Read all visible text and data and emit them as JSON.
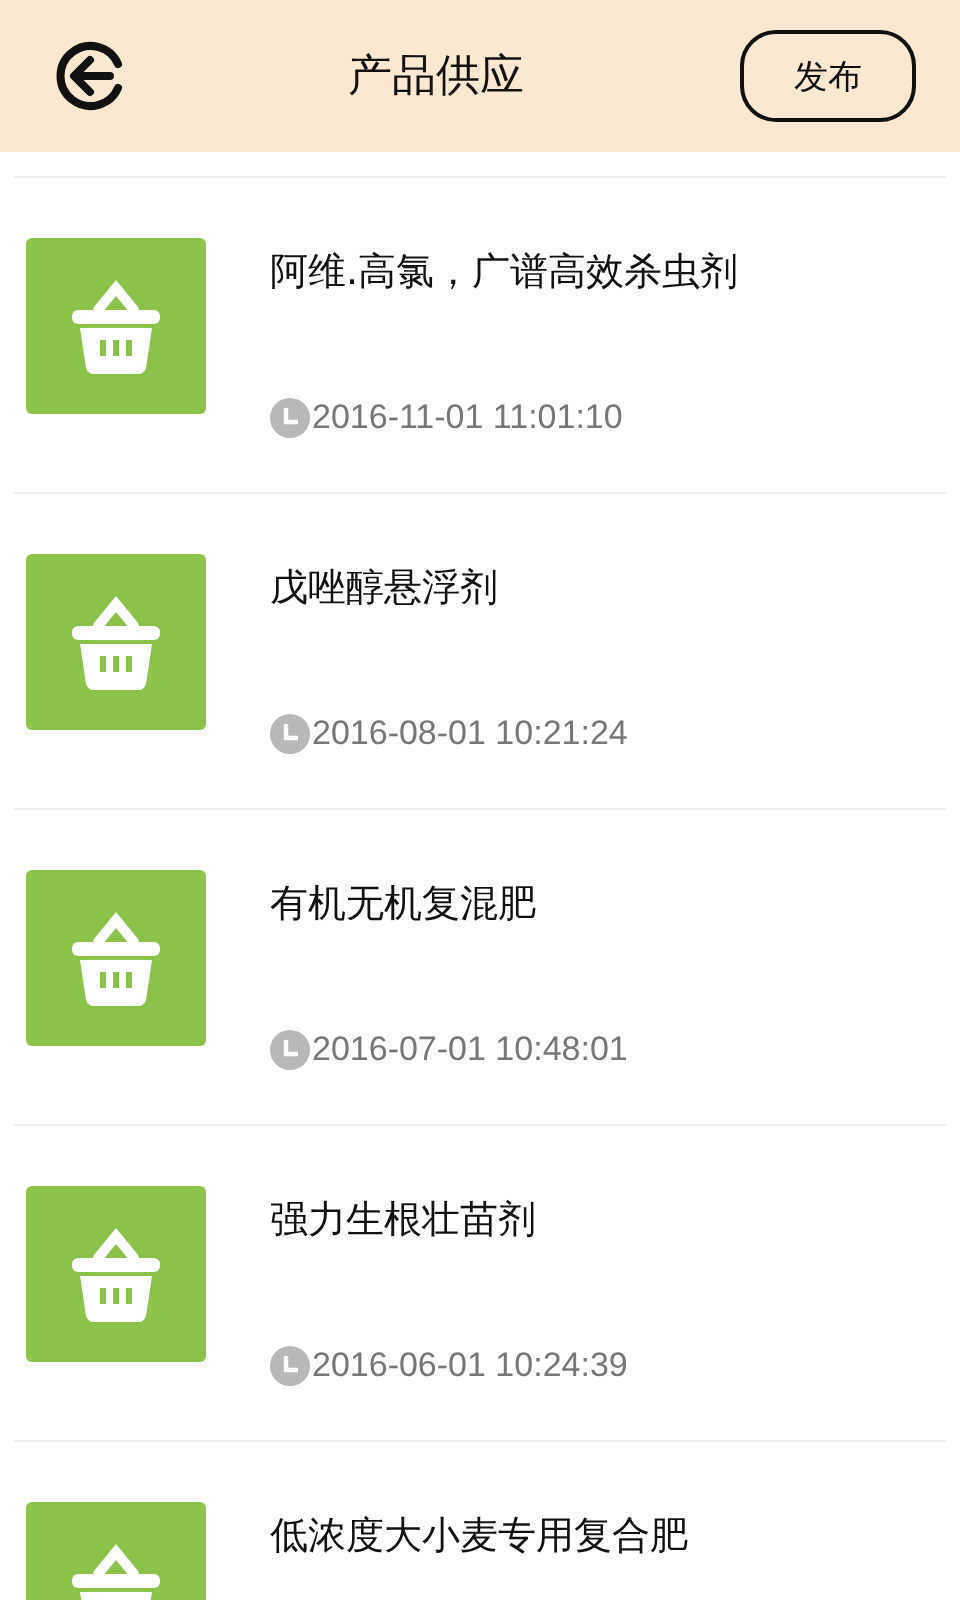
{
  "header": {
    "title": "产品供应",
    "action": "发布"
  },
  "products": [
    {
      "name": "阿维.高氯，广谱高效杀虫剂",
      "time": "2016-11-01 11:01:10"
    },
    {
      "name": "戊唑醇悬浮剂",
      "time": "2016-08-01 10:21:24"
    },
    {
      "name": "有机无机复混肥",
      "time": "2016-07-01 10:48:01"
    },
    {
      "name": "强力生根壮苗剂",
      "time": "2016-06-01 10:24:39"
    },
    {
      "name": "低浓度大小麦专用复合肥"
    }
  ]
}
